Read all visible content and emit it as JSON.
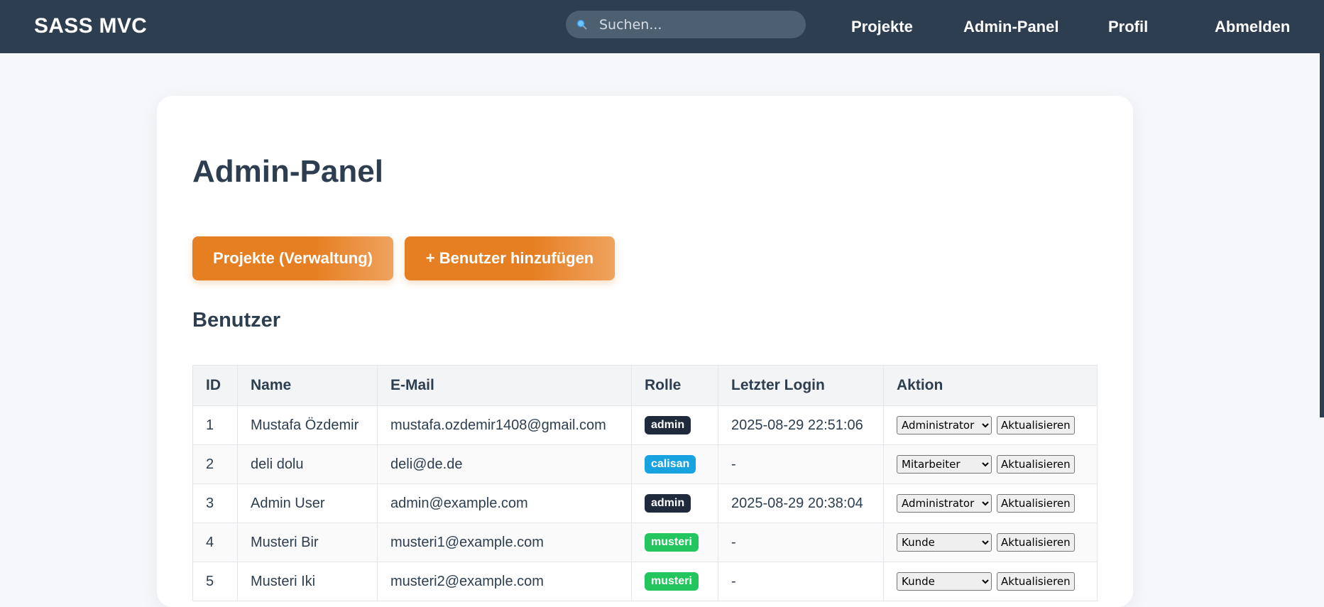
{
  "navbar": {
    "brand": "SASS MVC",
    "search_placeholder": "Suchen...",
    "links": [
      "Projekte",
      "Admin-Panel",
      "Profil",
      "Abmelden"
    ]
  },
  "page": {
    "title": "Admin-Panel",
    "buttons": {
      "projects": "Projekte (Verwaltung)",
      "add_user": "+ Benutzer hinzufügen"
    },
    "section_title": "Benutzer"
  },
  "table": {
    "headers": [
      "ID",
      "Name",
      "E-Mail",
      "Rolle",
      "Letzter Login",
      "Aktion"
    ],
    "update_label": "Aktualisieren",
    "rows": [
      {
        "id": "1",
        "name": "Mustafa Özdemir",
        "email": "mustafa.ozdemir1408@gmail.com",
        "role_badge": "admin",
        "last_login": "2025-08-29 22:51:06",
        "selected_role": "Administrator"
      },
      {
        "id": "2",
        "name": "deli dolu",
        "email": "deli@de.de",
        "role_badge": "calisan",
        "last_login": "-",
        "selected_role": "Mitarbeiter"
      },
      {
        "id": "3",
        "name": "Admin User",
        "email": "admin@example.com",
        "role_badge": "admin",
        "last_login": "2025-08-29 20:38:04",
        "selected_role": "Administrator"
      },
      {
        "id": "4",
        "name": "Musteri Bir",
        "email": "musteri1@example.com",
        "role_badge": "musteri",
        "last_login": "-",
        "selected_role": "Kunde"
      },
      {
        "id": "5",
        "name": "Musteri Iki",
        "email": "musteri2@example.com",
        "role_badge": "musteri",
        "last_login": "-",
        "selected_role": "Kunde"
      }
    ]
  },
  "colors": {
    "navbar": "#2c3e50",
    "accent": "#e67e22",
    "badge_admin": "#1f2a3c",
    "badge_calisan": "#17a2e0",
    "badge_musteri": "#22c55e"
  },
  "icons": {
    "search": "search-icon"
  }
}
